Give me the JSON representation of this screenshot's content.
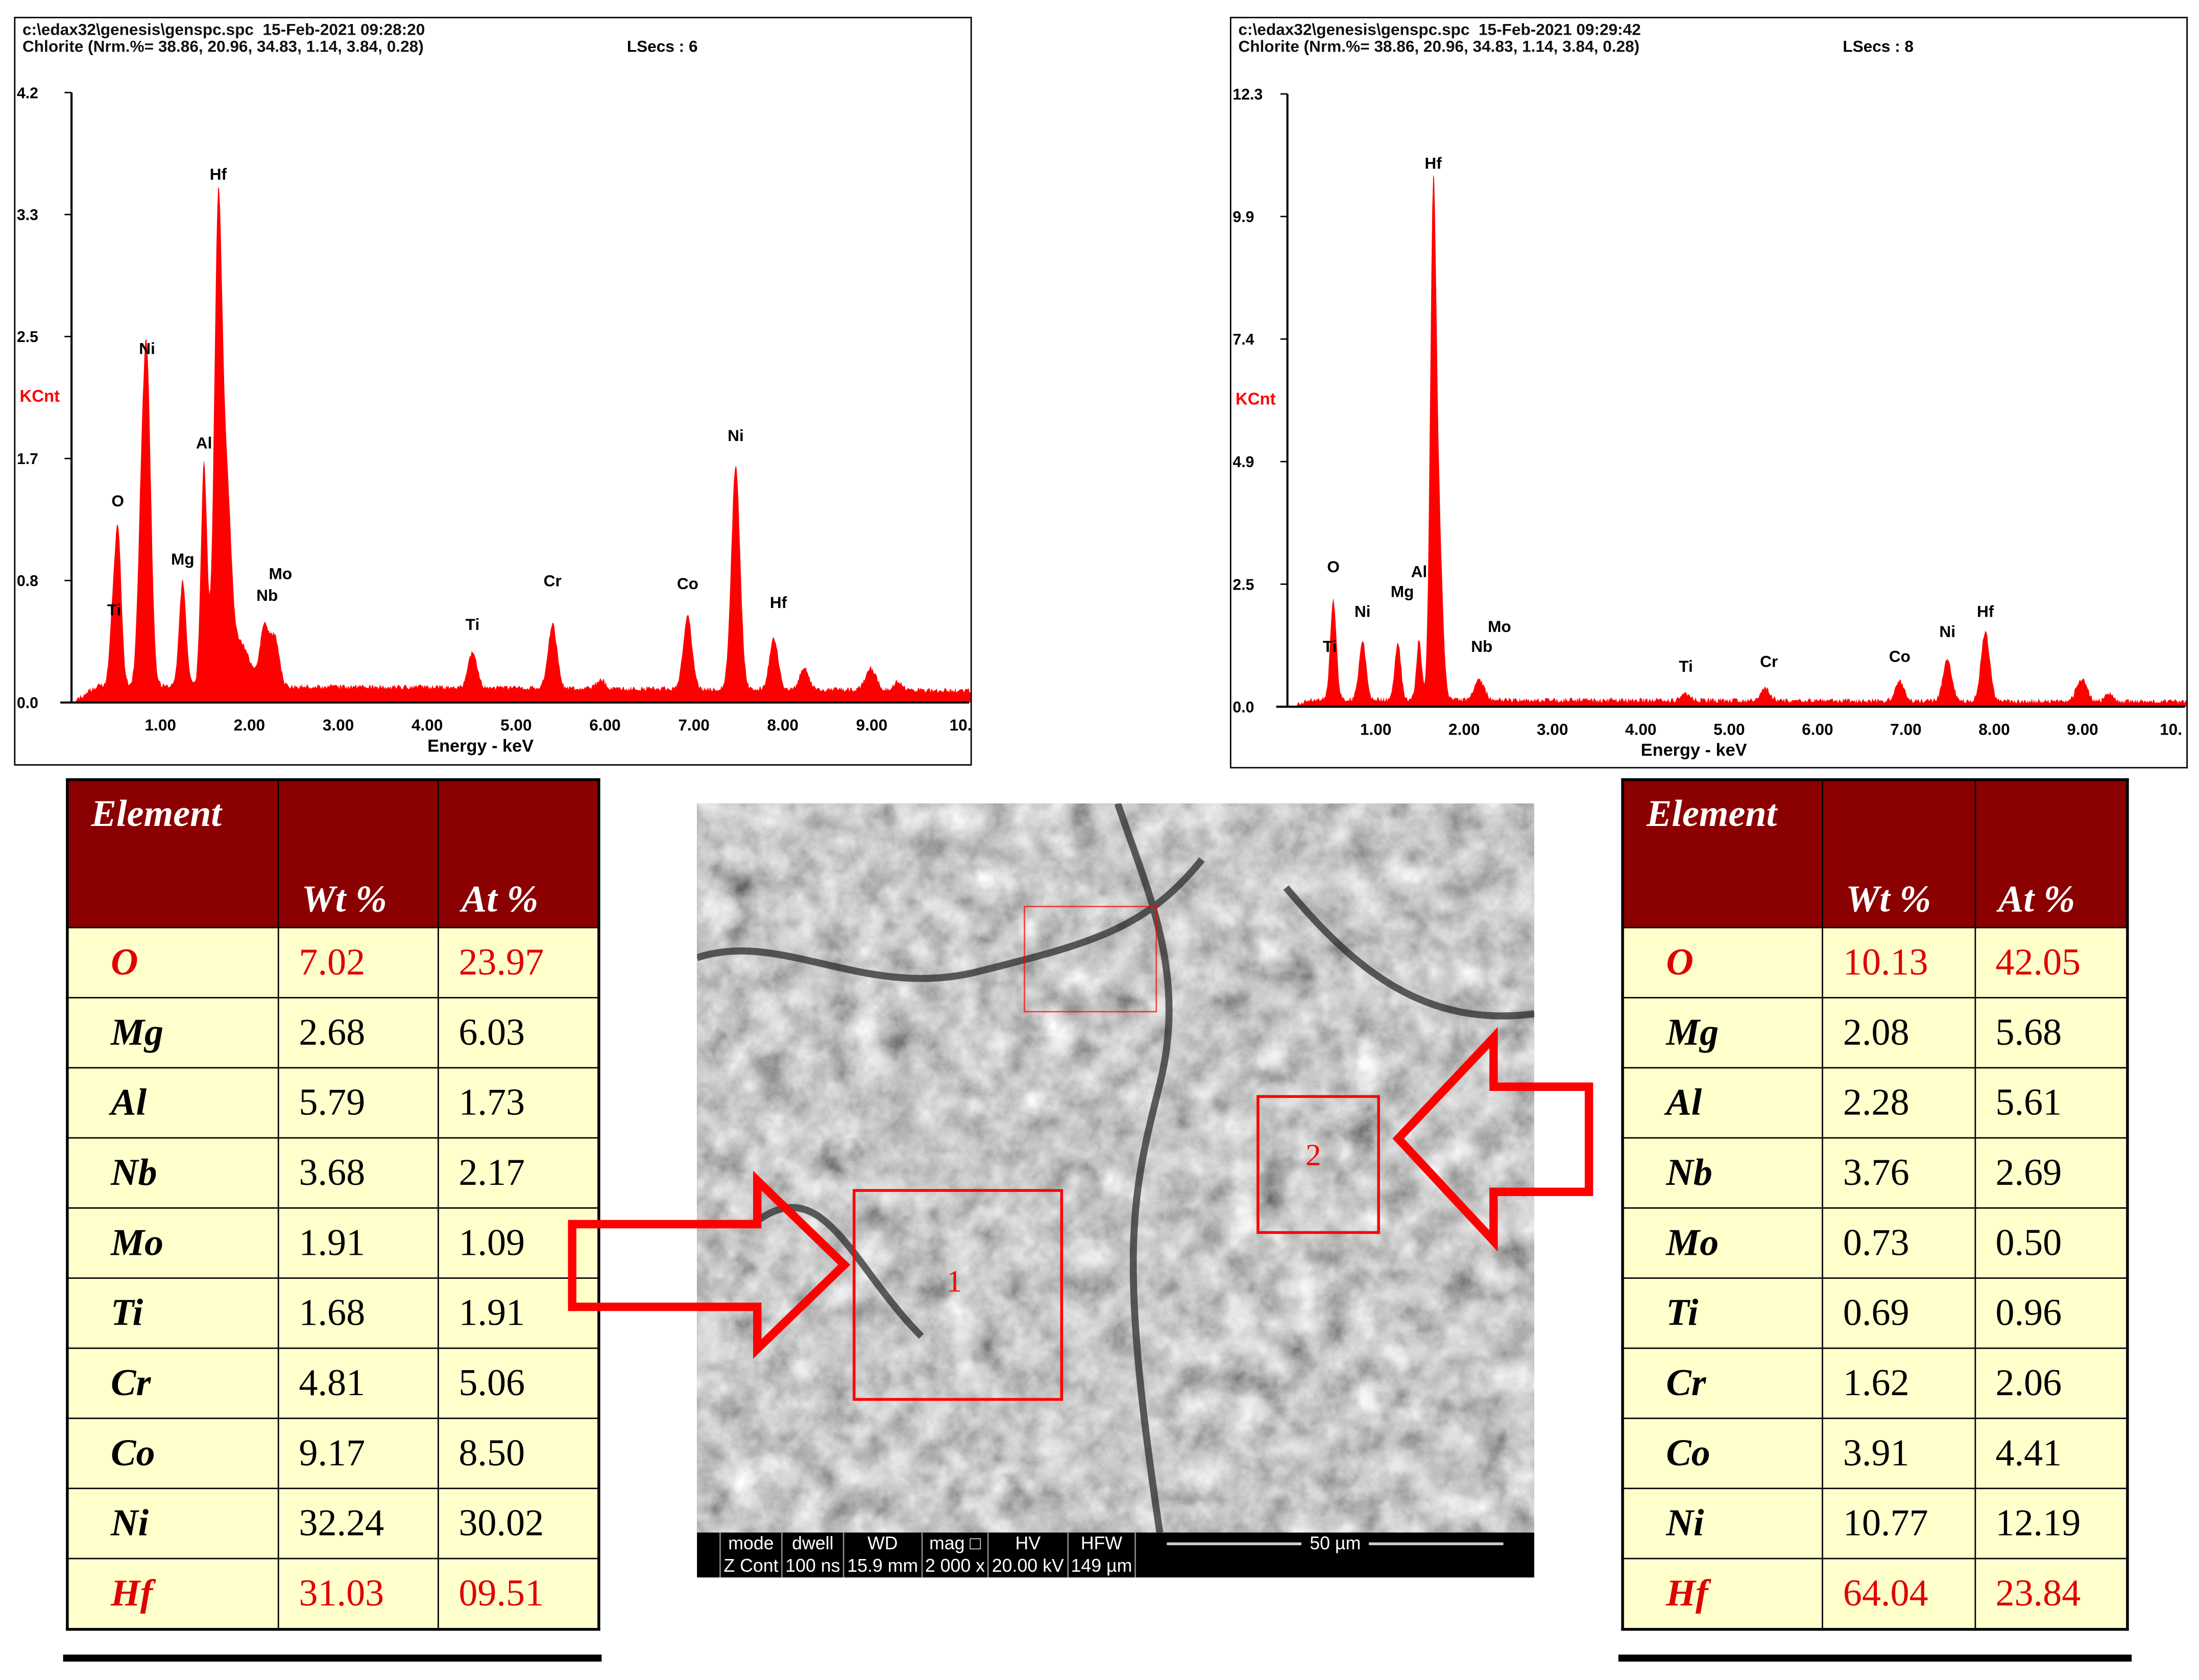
{
  "spectra": [
    {
      "header_line1": "c:\\edax32\\genesis\\genspc.spc  15-Feb-2021 09:28:20",
      "header_line2": "Chlorite (Nrm.%= 38.86, 20.96, 34.83, 1.14, 3.84, 0.28)",
      "lsecs": "LSecs :  6",
      "ylabel": "KCnt",
      "xlabel": "Energy - keV",
      "yticks": [
        "4.2",
        "3.3",
        "2.5",
        "1.7",
        "0.8",
        "0.0"
      ],
      "ymax": 4.2,
      "xticks": [
        "1.00",
        "2.00",
        "3.00",
        "4.00",
        "5.00",
        "6.00",
        "7.00",
        "8.00",
        "9.00",
        "10."
      ],
      "peaks": [
        [
          0.52,
          1.1,
          0.04
        ],
        [
          0.45,
          0.3,
          0.03
        ],
        [
          0.85,
          2.15,
          0.045
        ],
        [
          0.78,
          0.9,
          0.04
        ],
        [
          1.25,
          0.72,
          0.04
        ],
        [
          1.49,
          1.55,
          0.035
        ],
        [
          1.65,
          3.25,
          0.045
        ],
        [
          1.75,
          1.2,
          0.05
        ],
        [
          1.9,
          0.3,
          0.1
        ],
        [
          2.17,
          0.42,
          0.05
        ],
        [
          2.29,
          0.33,
          0.05
        ],
        [
          4.51,
          0.25,
          0.05
        ],
        [
          5.41,
          0.45,
          0.05
        ],
        [
          5.95,
          0.06,
          0.05
        ],
        [
          6.93,
          0.5,
          0.05
        ],
        [
          7.47,
          1.55,
          0.05
        ],
        [
          7.9,
          0.35,
          0.05
        ],
        [
          8.24,
          0.15,
          0.05
        ],
        [
          8.99,
          0.15,
          0.06
        ],
        [
          9.3,
          0.06,
          0.05
        ]
      ],
      "background": 0.12,
      "labels": [
        [
          "O",
          0.52,
          1.35
        ],
        [
          "Ti",
          0.48,
          0.6
        ],
        [
          "Ni",
          0.85,
          2.4
        ],
        [
          "Mg",
          1.25,
          0.95
        ],
        [
          "Al",
          1.49,
          1.75
        ],
        [
          "Hf",
          1.65,
          3.6
        ],
        [
          "Mo",
          2.35,
          0.85
        ],
        [
          "Nb",
          2.2,
          0.7
        ],
        [
          "Ti",
          4.51,
          0.5
        ],
        [
          "Cr",
          5.41,
          0.8
        ],
        [
          "Co",
          6.93,
          0.78
        ],
        [
          "Ni",
          7.47,
          1.8
        ],
        [
          "Hf",
          7.95,
          0.65
        ]
      ]
    },
    {
      "header_line1": "c:\\edax32\\genesis\\genspc.spc  15-Feb-2021 09:29:42",
      "header_line2": "Chlorite (Nrm.%= 38.86, 20.96, 34.83, 1.14, 3.84, 0.28)",
      "lsecs": "LSecs :  8",
      "ylabel": "KCnt",
      "xlabel": "Energy - keV",
      "yticks": [
        "12.3",
        "9.9",
        "7.4",
        "4.9",
        "2.5",
        "0.0"
      ],
      "ymax": 12.3,
      "peaks": [
        [
          0.52,
          2.0,
          0.035
        ],
        [
          0.85,
          1.2,
          0.04
        ],
        [
          1.25,
          1.15,
          0.035
        ],
        [
          1.49,
          1.2,
          0.03
        ],
        [
          1.65,
          9.9,
          0.035
        ],
        [
          1.72,
          3.0,
          0.04
        ],
        [
          2.17,
          0.4,
          0.06
        ],
        [
          4.51,
          0.15,
          0.05
        ],
        [
          5.41,
          0.25,
          0.05
        ],
        [
          6.93,
          0.4,
          0.05
        ],
        [
          7.47,
          0.85,
          0.05
        ],
        [
          7.9,
          1.4,
          0.05
        ],
        [
          8.99,
          0.45,
          0.06
        ],
        [
          9.3,
          0.15,
          0.05
        ]
      ],
      "background": 0.15,
      "xticks": [
        "1.00",
        "2.00",
        "3.00",
        "4.00",
        "5.00",
        "6.00",
        "7.00",
        "8.00",
        "9.00",
        "10."
      ],
      "labels": [
        [
          "O",
          0.52,
          2.7
        ],
        [
          "Ti",
          0.48,
          1.1
        ],
        [
          "Ni",
          0.85,
          1.8
        ],
        [
          "Mg",
          1.3,
          2.2
        ],
        [
          "Al",
          1.49,
          2.6
        ],
        [
          "Hf",
          1.65,
          10.8
        ],
        [
          "Mo",
          2.4,
          1.5
        ],
        [
          "Nb",
          2.2,
          1.1
        ],
        [
          "Ti",
          4.51,
          0.7
        ],
        [
          "Cr",
          5.45,
          0.8
        ],
        [
          "Co",
          6.93,
          0.9
        ],
        [
          "Ni",
          7.47,
          1.4
        ],
        [
          "Hf",
          7.9,
          1.8
        ]
      ]
    }
  ],
  "tables": [
    {
      "headers": [
        "Element",
        "Wt %",
        "At %"
      ],
      "rows": [
        [
          "O",
          "7.02",
          "23.97"
        ],
        [
          "Mg",
          "2.68",
          "6.03"
        ],
        [
          "Al",
          "5.79",
          "1.73"
        ],
        [
          "Nb",
          "3.68",
          "2.17"
        ],
        [
          "Mo",
          "1.91",
          "1.09"
        ],
        [
          "Ti",
          "1.68",
          "1.91"
        ],
        [
          "Cr",
          "4.81",
          "5.06"
        ],
        [
          "Co",
          "9.17",
          "8.50"
        ],
        [
          "Ni",
          "32.24",
          "30.02"
        ],
        [
          "Hf",
          "31.03",
          "09.51"
        ]
      ]
    },
    {
      "headers": [
        "Element",
        "Wt %",
        "At %"
      ],
      "rows": [
        [
          "O",
          "10.13",
          "42.05"
        ],
        [
          "Mg",
          "2.08",
          "5.68"
        ],
        [
          "Al",
          "2.28",
          "5.61"
        ],
        [
          "Nb",
          "3.76",
          "2.69"
        ],
        [
          "Mo",
          "0.73",
          "0.50"
        ],
        [
          "Ti",
          "0.69",
          "0.96"
        ],
        [
          "Cr",
          "1.62",
          "2.06"
        ],
        [
          "Co",
          "3.91",
          "4.41"
        ],
        [
          "Ni",
          "10.77",
          "12.19"
        ],
        [
          "Hf",
          "64.04",
          "23.84"
        ]
      ]
    }
  ],
  "sem": {
    "region1": "1",
    "region2": "2",
    "info": [
      [
        "mode",
        "Z Cont"
      ],
      [
        "dwell",
        "100 ns"
      ],
      [
        "WD",
        "15.9 mm"
      ],
      [
        "mag □",
        "2 000 x"
      ],
      [
        "HV",
        "20.00 kV"
      ],
      [
        "HFW",
        "149 µm"
      ]
    ],
    "scale": "50 µm"
  },
  "colors": {
    "spectrum": "#ff0000",
    "header": "#8b0000",
    "cell": "#ffffcc",
    "highlight": "#e00000"
  }
}
